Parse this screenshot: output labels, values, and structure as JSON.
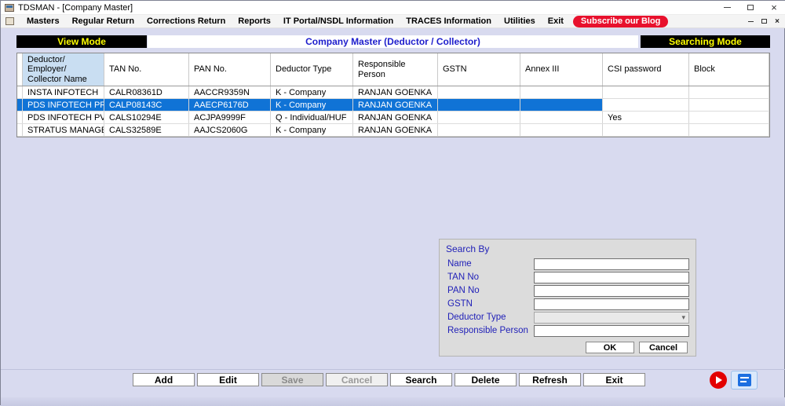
{
  "window": {
    "title": "TDSMAN - [Company Master]"
  },
  "menu": {
    "items": [
      {
        "label": "Masters"
      },
      {
        "label": "Regular Return"
      },
      {
        "label": "Corrections Return"
      },
      {
        "label": "Reports"
      },
      {
        "label": "IT Portal/NSDL Information"
      },
      {
        "label": "TRACES Information"
      },
      {
        "label": "Utilities"
      },
      {
        "label": "Exit"
      }
    ],
    "blog_badge": "Subscribe our Blog"
  },
  "mode_bar": {
    "left": "View Mode",
    "center": "Company Master (Deductor / Collector)",
    "right": "Searching Mode"
  },
  "table": {
    "columns": [
      "Deductor/\nEmployer/\nCollector Name",
      "TAN No.",
      "PAN No.",
      "Deductor Type",
      "Responsible\nPerson",
      "GSTN",
      "Annex III",
      "CSI password",
      "Block"
    ],
    "rows": [
      {
        "selected": false,
        "cells": [
          "INSTA INFOTECH",
          "CALR08361D",
          "AACCR9359N",
          "K - Company",
          "RANJAN  GOENKA",
          "",
          "",
          "",
          ""
        ]
      },
      {
        "selected": true,
        "cells": [
          "PDS INFOTECH PRIV...",
          "CALP08143C",
          "AAECP6176D",
          "K - Company",
          "RANJAN  GOENKA",
          "",
          "",
          "",
          ""
        ]
      },
      {
        "selected": false,
        "cells": [
          "PDS INFOTECH PVT ...",
          "CALS10294E",
          "ACJPA9999F",
          "Q - Individual/HUF",
          "RANJAN  GOENKA",
          "",
          "",
          "Yes",
          ""
        ]
      },
      {
        "selected": false,
        "cells": [
          "STRATUS MANAGEM...",
          "CALS32589E",
          "AAJCS2060G",
          "K - Company",
          "RANJAN  GOENKA",
          "",
          "",
          "",
          ""
        ]
      }
    ]
  },
  "search_panel": {
    "title": "Search By",
    "fields": [
      {
        "label": "Name",
        "value": "",
        "type": "text"
      },
      {
        "label": "TAN No",
        "value": "",
        "type": "text"
      },
      {
        "label": "PAN No",
        "value": "",
        "type": "text"
      },
      {
        "label": "GSTN",
        "value": "",
        "type": "text"
      },
      {
        "label": "Deductor Type",
        "value": "",
        "type": "select"
      },
      {
        "label": "Responsible Person",
        "value": "",
        "type": "text"
      }
    ],
    "ok_label": "OK",
    "cancel_label": "Cancel"
  },
  "action_bar": {
    "buttons": [
      {
        "label": "Add",
        "enabled": true
      },
      {
        "label": "Edit",
        "enabled": true
      },
      {
        "label": "Save",
        "enabled": false
      },
      {
        "label": "Cancel",
        "enabled": false
      },
      {
        "label": "Search",
        "enabled": true
      },
      {
        "label": "Delete",
        "enabled": true
      },
      {
        "label": "Refresh",
        "enabled": true
      },
      {
        "label": "Exit",
        "enabled": true
      }
    ]
  },
  "icons": {
    "close": "×",
    "mdi_close": "×"
  },
  "colors": {
    "selection_blue": "#1073d6",
    "mode_bar_bg": "#000000",
    "mode_bar_text": "#ffff00",
    "header_title_blue": "#1d1dcc",
    "blog_badge_red": "#e8112d",
    "background_lavender": "#d8daef",
    "header_first_col": "#c9def2"
  }
}
